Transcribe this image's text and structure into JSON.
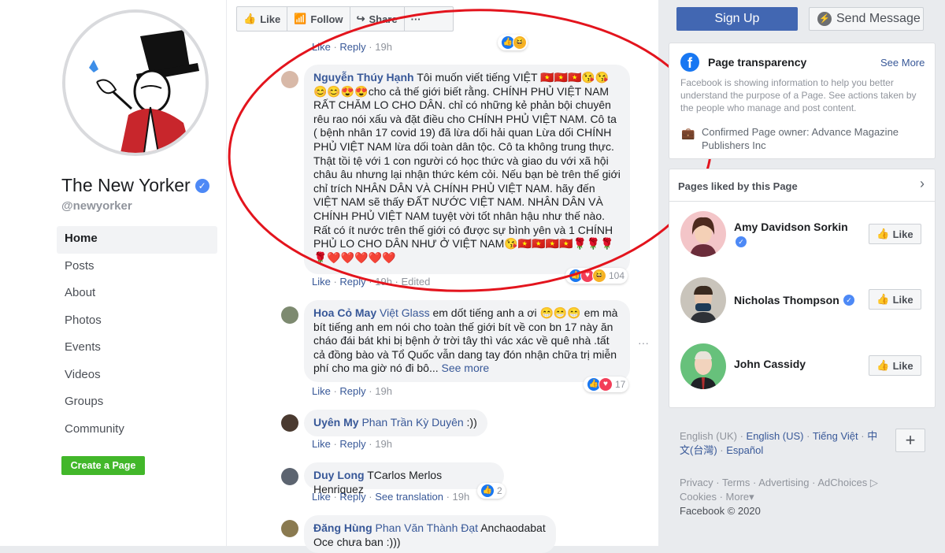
{
  "page": {
    "name": "The New Yorker",
    "handle": "@newyorker",
    "nav": [
      "Home",
      "Posts",
      "About",
      "Photos",
      "Events",
      "Videos",
      "Groups",
      "Community"
    ],
    "create_page": "Create a Page"
  },
  "actions": {
    "like": "Like",
    "follow": "Follow",
    "share": "Share",
    "more": "···",
    "sign_up": "Sign Up",
    "send_message": "Send Message"
  },
  "comments": {
    "top_meta": {
      "like": "Like",
      "reply": "Reply",
      "time": "19h"
    },
    "c1": {
      "author": "Nguyễn Thúy Hạnh",
      "text": "Tôi muốn viết tiếng VIỆT 🇻🇳🇻🇳🇻🇳😘😘😊😊😍😍cho cả thế giới biết rằng. CHÍNH PHỦ VIỆT NAM RẤT CHĂM LO CHO DÂN. chỉ có những kẻ phản bội chuyên rêu rao nói xấu và đặt điều cho CHÍNH PHỦ VIỆT NAM. Cô ta ( bệnh nhân 17 covid 19) đã lừa dối hải quan Lừa dối CHÍNH PHỦ VIỆT NAM lừa dối toàn dân tộc. Cô ta không trung thực. Thật tồi tệ với 1 con người có học thức và giao du với xã hội châu âu nhưng lại nhận thức kém cỏi. Nếu bạn bè trên thế giới chỉ trích NHÂN DÂN VÀ CHÍNH PHỦ VIỆT NAM. hãy đến VIỆT NAM sẽ thấy ĐẤT NƯỚC VIỆT NAM. NHÂN DÂN VÀ CHÍNH PHỦ VIỆT NAM tuyệt vời tốt nhân hậu như thế nào. Rất có ít nước trên thế giới có được sự bình yên và 1 CHÍNH PHỦ LO CHO DÂN NHƯ Ở VIỆT NAM😘🇻🇳🇻🇳🇻🇳🇻🇳🌹🌹🌹🌹❤️❤️❤️❤️❤️",
      "like": "Like",
      "reply": "Reply",
      "time": "19h",
      "edited": "Edited",
      "reactions": "104"
    },
    "c2": {
      "author": "Hoa Cỏ May",
      "tag": "Việt Glass",
      "text": "em dốt tiếng anh a ơi 😁😁😁 em mà bít tiếng anh em nói cho toàn thế giới bít về con bn 17 này ăn cháo đái bát khi bị bệnh ở trời tây thì vác xác về quê nhà .tất cả đồng bào và Tổ Quốc vẫn dang tay đón nhận chữa trị miễn phí cho ma giờ nó đi bô...",
      "see_more": "See more",
      "like": "Like",
      "reply": "Reply",
      "time": "19h",
      "reactions": "17"
    },
    "c3": {
      "author": "Uyên My",
      "tag": "Phan Trần Kỳ Duyên",
      "text": ":))",
      "like": "Like",
      "reply": "Reply",
      "time": "19h"
    },
    "c4": {
      "author": "Duy Long",
      "text": "TCarlos Merlos Henriquez",
      "like": "Like",
      "reply": "Reply",
      "translation": "See translation",
      "time": "19h",
      "reactions": "2"
    },
    "c5": {
      "author": "Đăng Hùng",
      "tag": "Phan Văn Thành Đạt",
      "text": "Anchaodabat Oce chưa ban :)))"
    }
  },
  "transparency": {
    "title": "Page transparency",
    "see_more": "See More",
    "desc": "Facebook is showing information to help you better understand the purpose of a Page. See actions taken by the people who manage and post content.",
    "owner": "Confirmed Page owner: Advance Magazine Publishers Inc"
  },
  "liked": {
    "title": "Pages liked by this Page",
    "people": [
      {
        "name": "Amy Davidson Sorkin",
        "button": "Like"
      },
      {
        "name": "Nicholas Thompson",
        "button": "Like"
      },
      {
        "name": "John Cassidy",
        "button": "Like"
      }
    ]
  },
  "languages": {
    "current": "English (UK)",
    "options": [
      "English (US)",
      "Tiếng Việt",
      "中文(台灣)",
      "Español"
    ]
  },
  "footer": {
    "links": [
      "Privacy",
      "Terms",
      "Advertising",
      "AdChoices",
      "Cookies",
      "More"
    ],
    "copyright": "Facebook © 2020"
  },
  "colors": {
    "brand": "#4267b2",
    "link": "#385898",
    "annotation": "#e3141d",
    "create": "#42b72a"
  }
}
